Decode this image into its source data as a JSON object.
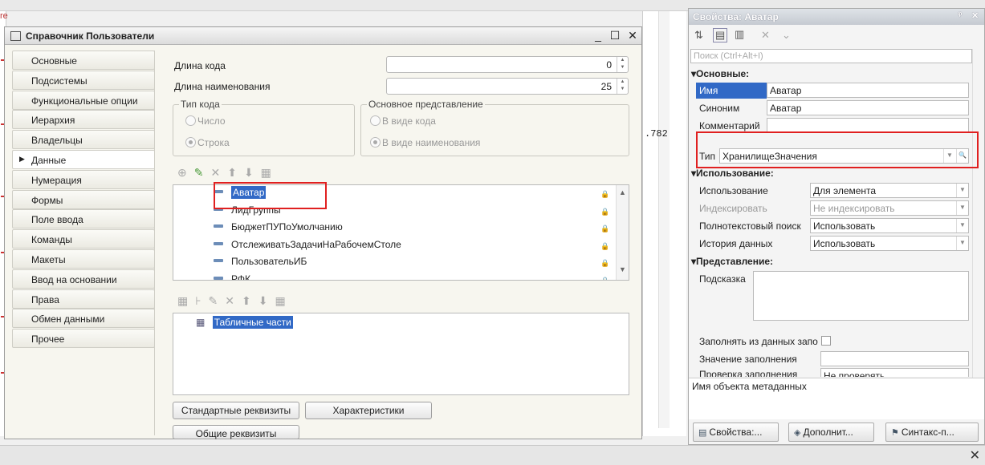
{
  "stub_text": "re",
  "window": {
    "title": "Справочник Пользователи",
    "min": "_",
    "max": "☐",
    "close": "✕"
  },
  "sidebar": [
    {
      "label": "Основные"
    },
    {
      "label": "Подсистемы"
    },
    {
      "label": "Функциональные опции"
    },
    {
      "label": "Иерархия"
    },
    {
      "label": "Владельцы"
    },
    {
      "label": "Данные",
      "active": true
    },
    {
      "label": "Нумерация"
    },
    {
      "label": "Формы"
    },
    {
      "label": "Поле ввода"
    },
    {
      "label": "Команды"
    },
    {
      "label": "Макеты"
    },
    {
      "label": "Ввод на основании"
    },
    {
      "label": "Права"
    },
    {
      "label": "Обмен данными"
    },
    {
      "label": "Прочее"
    }
  ],
  "form": {
    "code_length_label": "Длина кода",
    "code_length_value": "0",
    "name_length_label": "Длина наименования",
    "name_length_value": "25",
    "code_type_legend": "Тип кода",
    "code_type_number": "Число",
    "code_type_string": "Строка",
    "main_repr_legend": "Основное представление",
    "repr_code": "В виде кода",
    "repr_name": "В виде наименования"
  },
  "attributes": [
    "Аватар",
    "ЛидГруппы",
    "БюджетПУПоУмолчанию",
    "ОтслеживатьЗадачиНаРабочемСтоле",
    "ПользовательИБ",
    "РФК"
  ],
  "tabular_root": "Табличные части",
  "buttons": {
    "std": "Стандартные реквизиты",
    "chars": "Характеристики",
    "common": "Общие реквизиты"
  },
  "mid_number": ".782",
  "props": {
    "title": "Свойства: Аватар",
    "search_placeholder": "Поиск (Ctrl+Alt+I)",
    "sec_basic": "Основные:",
    "name_label": "Имя",
    "name_value": "Аватар",
    "synonym_label": "Синоним",
    "synonym_value": "Аватар",
    "comment_label": "Комментарий",
    "comment_value": "",
    "type_label": "Тип",
    "type_value": "ХранилищеЗначения",
    "sec_usage": "Использование:",
    "usage_label": "Использование",
    "usage_value": "Для элемента",
    "index_label": "Индексировать",
    "index_value": "Не индексировать",
    "fulltext_label": "Полнотекстовый поиск",
    "fulltext_value": "Использовать",
    "history_label": "История данных",
    "history_value": "Использовать",
    "sec_repr": "Представление:",
    "hint_label": "Подсказка",
    "fill_from_label": "Заполнять из данных запо",
    "fill_value_label": "Значение заполнения",
    "fill_check_label": "Проверка заполнения",
    "fill_check_value": "Не проверять",
    "description": "Имя объекта метаданных",
    "tabs": [
      "Свойства:...",
      "Дополнит...",
      "Синтакс-п..."
    ]
  },
  "colors": {
    "selection": "#3169c6",
    "highlight": "#e02020"
  }
}
